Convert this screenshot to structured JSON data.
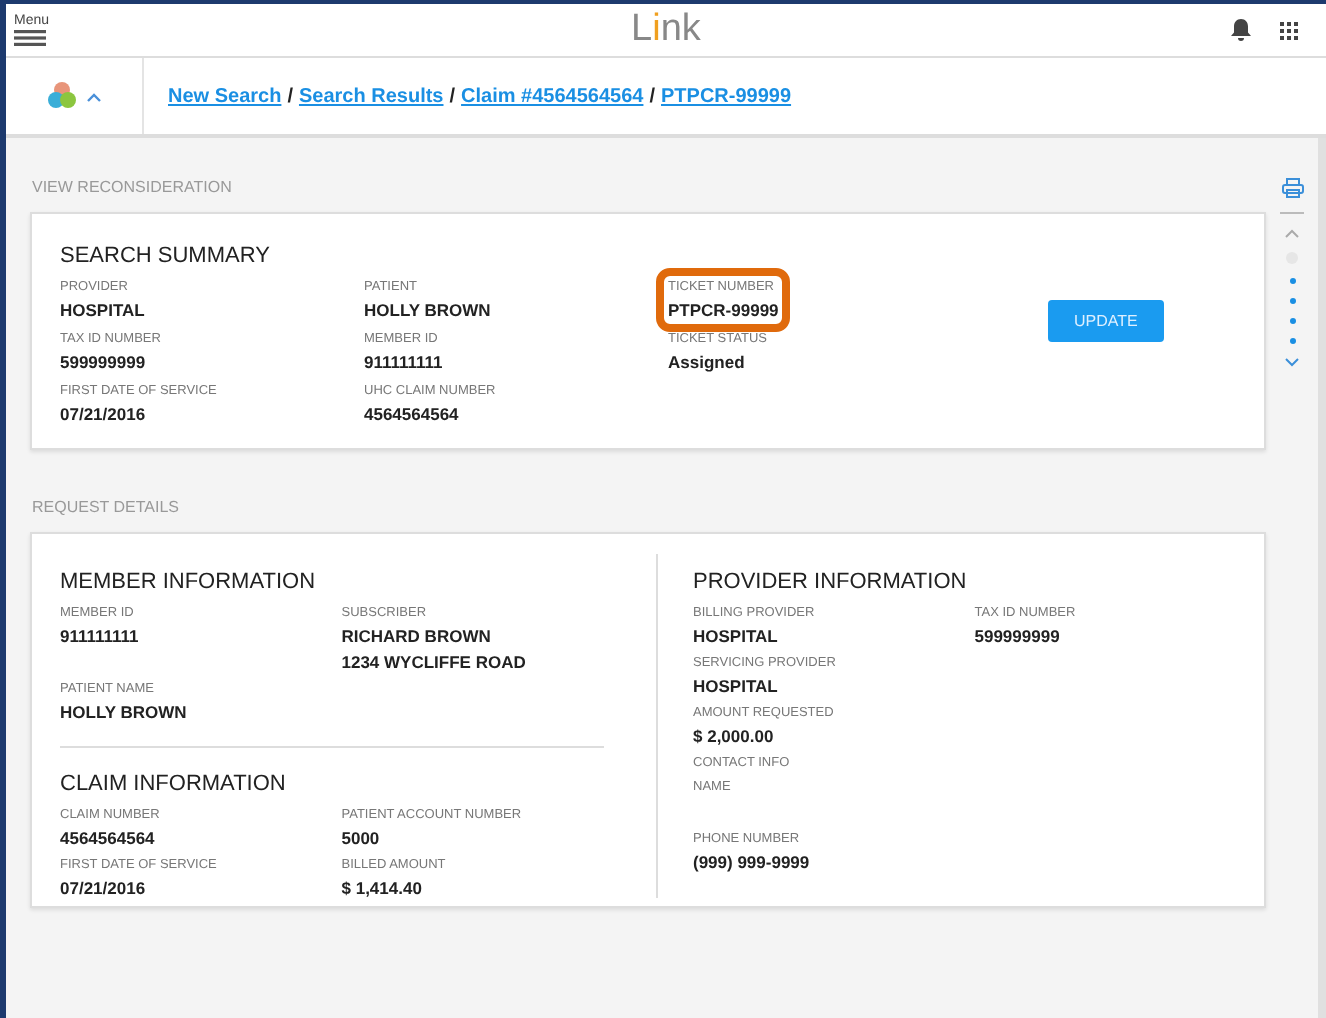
{
  "header": {
    "menu_label": "Menu",
    "logo": {
      "before": "L",
      "accent": "i",
      "after": "nk"
    }
  },
  "breadcrumbs": [
    "New Search",
    "Search Results",
    "Claim #4564564564",
    "PTPCR-99999"
  ],
  "breadcrumb_separator": "/",
  "view_section": {
    "title": "VIEW RECONSIDERATION",
    "summary": {
      "title": "SEARCH SUMMARY",
      "button": "UPDATE",
      "columns": [
        [
          {
            "label": "PROVIDER",
            "value": "HOSPITAL",
            "highlighted": false
          },
          {
            "label": "TAX ID NUMBER",
            "value": "599999999",
            "highlighted": false
          },
          {
            "label": "FIRST DATE OF SERVICE",
            "value": "07/21/2016",
            "highlighted": false
          }
        ],
        [
          {
            "label": "PATIENT",
            "value": "HOLLY BROWN",
            "highlighted": false
          },
          {
            "label": "MEMBER ID",
            "value": "911111111",
            "highlighted": false
          },
          {
            "label": "UHC CLAIM NUMBER",
            "value": "4564564564",
            "highlighted": false
          }
        ],
        [
          {
            "label": "TICKET NUMBER",
            "value": "PTPCR-99999",
            "highlighted": true
          },
          {
            "label": "TICKET STATUS",
            "value": "Assigned",
            "highlighted": false
          }
        ]
      ]
    }
  },
  "nav_dots": [
    {
      "selected": true
    },
    {
      "selected": false
    },
    {
      "selected": false
    },
    {
      "selected": false
    },
    {
      "selected": false
    }
  ],
  "request_section": {
    "title": "REQUEST DETAILS",
    "member": {
      "title": "MEMBER INFORMATION",
      "fields": [
        {
          "label": "MEMBER ID",
          "lines": [
            "911111111"
          ]
        },
        {
          "label": "SUBSCRIBER",
          "lines": [
            "RICHARD BROWN",
            "1234 WYCLIFFE ROAD"
          ]
        },
        {
          "label": "PATIENT NAME",
          "lines": [
            "HOLLY BROWN"
          ]
        }
      ]
    },
    "claim": {
      "title": "CLAIM INFORMATION",
      "fields": [
        {
          "label": "CLAIM NUMBER",
          "lines": [
            "4564564564"
          ]
        },
        {
          "label": "PATIENT ACCOUNT NUMBER",
          "lines": [
            "5000"
          ]
        },
        {
          "label": "FIRST DATE OF SERVICE",
          "lines": [
            "07/21/2016"
          ]
        },
        {
          "label": "BILLED AMOUNT",
          "lines": [
            "$ 1,414.40"
          ]
        }
      ]
    },
    "provider": {
      "title": "PROVIDER INFORMATION",
      "fields": [
        {
          "label": "BILLING PROVIDER",
          "lines": [
            "HOSPITAL"
          ]
        },
        {
          "label": "TAX ID NUMBER",
          "lines": [
            "599999999"
          ]
        },
        {
          "label": "SERVICING PROVIDER",
          "lines": [
            "HOSPITAL"
          ],
          "kind": "full"
        },
        {
          "label": "AMOUNT REQUESTED",
          "lines": [
            "$ 2,000.00"
          ],
          "kind": "full"
        },
        {
          "label": "CONTACT INFO",
          "sublabel": "NAME",
          "kind": "full"
        },
        {
          "label": "PHONE NUMBER",
          "lines": [
            "(999) 999-9999"
          ],
          "kind": "full"
        }
      ]
    }
  }
}
